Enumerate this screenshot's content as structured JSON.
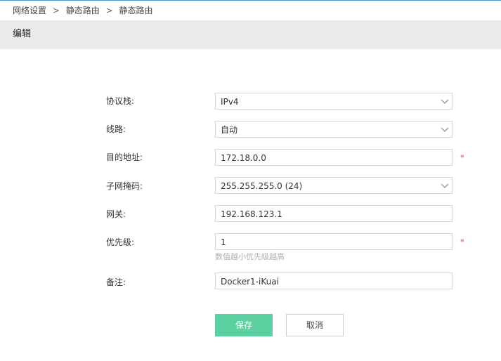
{
  "breadcrumb": {
    "items": [
      "网络设置",
      "静态路由",
      "静态路由"
    ],
    "separator": ">"
  },
  "header": {
    "title": "编辑"
  },
  "form": {
    "protocol": {
      "label": "协议栈:",
      "value": "IPv4"
    },
    "line": {
      "label": "线路:",
      "value": "自动"
    },
    "destination": {
      "label": "目的地址:",
      "value": "172.18.0.0",
      "required_mark": "*"
    },
    "netmask": {
      "label": "子网掩码:",
      "value": "255.255.255.0 (24)"
    },
    "gateway": {
      "label": "网关:",
      "value": "192.168.123.1"
    },
    "priority": {
      "label": "优先级:",
      "value": "1",
      "required_mark": "*",
      "hint": "数值越小优先级越高"
    },
    "remark": {
      "label": "备注:",
      "value": "Docker1-iKuai"
    }
  },
  "buttons": {
    "save": "保存",
    "cancel": "取消"
  },
  "colors": {
    "save_button": "#5cd0a0",
    "required": "#e53935",
    "header_bg": "#ebebeb"
  },
  "icons": {
    "dropdown": "chevron-down-icon"
  }
}
